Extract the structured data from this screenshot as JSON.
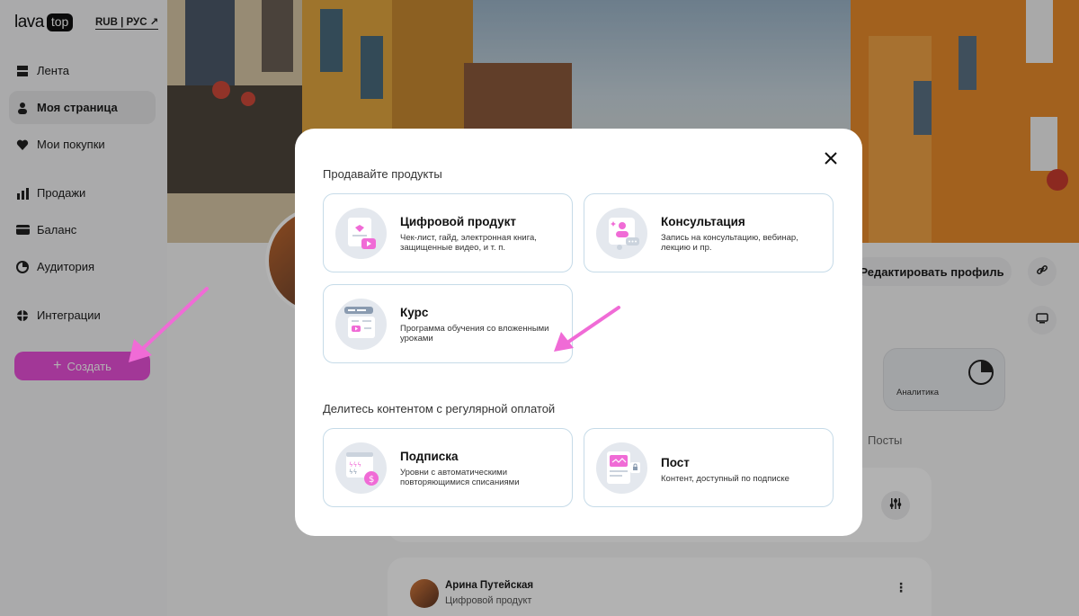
{
  "logo": {
    "word": "lava",
    "badge": "top"
  },
  "currency_language": "RUB | РУС ↗",
  "sidebar": {
    "items": [
      {
        "label": "Лента",
        "icon": "feed-icon"
      },
      {
        "label": "Моя страница",
        "icon": "user-icon"
      },
      {
        "label": "Мои покупки",
        "icon": "heart-icon"
      },
      {
        "label": "Продажи",
        "icon": "bar-chart-icon"
      },
      {
        "label": "Баланс",
        "icon": "wallet-icon"
      },
      {
        "label": "Аудитория",
        "icon": "pie-chart-icon"
      },
      {
        "label": "Интеграции",
        "icon": "integrations-icon"
      }
    ],
    "create_button": "Создать"
  },
  "profile": {
    "edit_button": "Редактировать профиль",
    "analytics_label": "Аналитика",
    "posts_tab": "Посты"
  },
  "post": {
    "author": "Арина Путейская",
    "type": "Цифровой продукт"
  },
  "modal": {
    "section_sell": "Продавайте продукты",
    "section_share": "Делитесь контентом с регулярной оплатой",
    "cards": [
      {
        "title": "Цифровой продукт",
        "desc": "Чек-лист, гайд, электронная книга, защищенные видео, и т. п.",
        "icon": "digital-product-icon"
      },
      {
        "title": "Консультация",
        "desc": "Запись на консультацию, вебинар, лекцию и пр.",
        "icon": "consultation-icon"
      },
      {
        "title": "Курс",
        "desc": "Программа обучения со вложенными уроками",
        "icon": "course-icon"
      },
      {
        "title": "Подписка",
        "desc": "Уровни с автоматическими повторяющимися списаниями",
        "icon": "subscription-icon"
      },
      {
        "title": "Пост",
        "desc": "Контент, доступный по подписке",
        "icon": "post-icon"
      }
    ]
  },
  "colors": {
    "accent": "#e84fd8",
    "card_border": "#c6dbe8"
  }
}
